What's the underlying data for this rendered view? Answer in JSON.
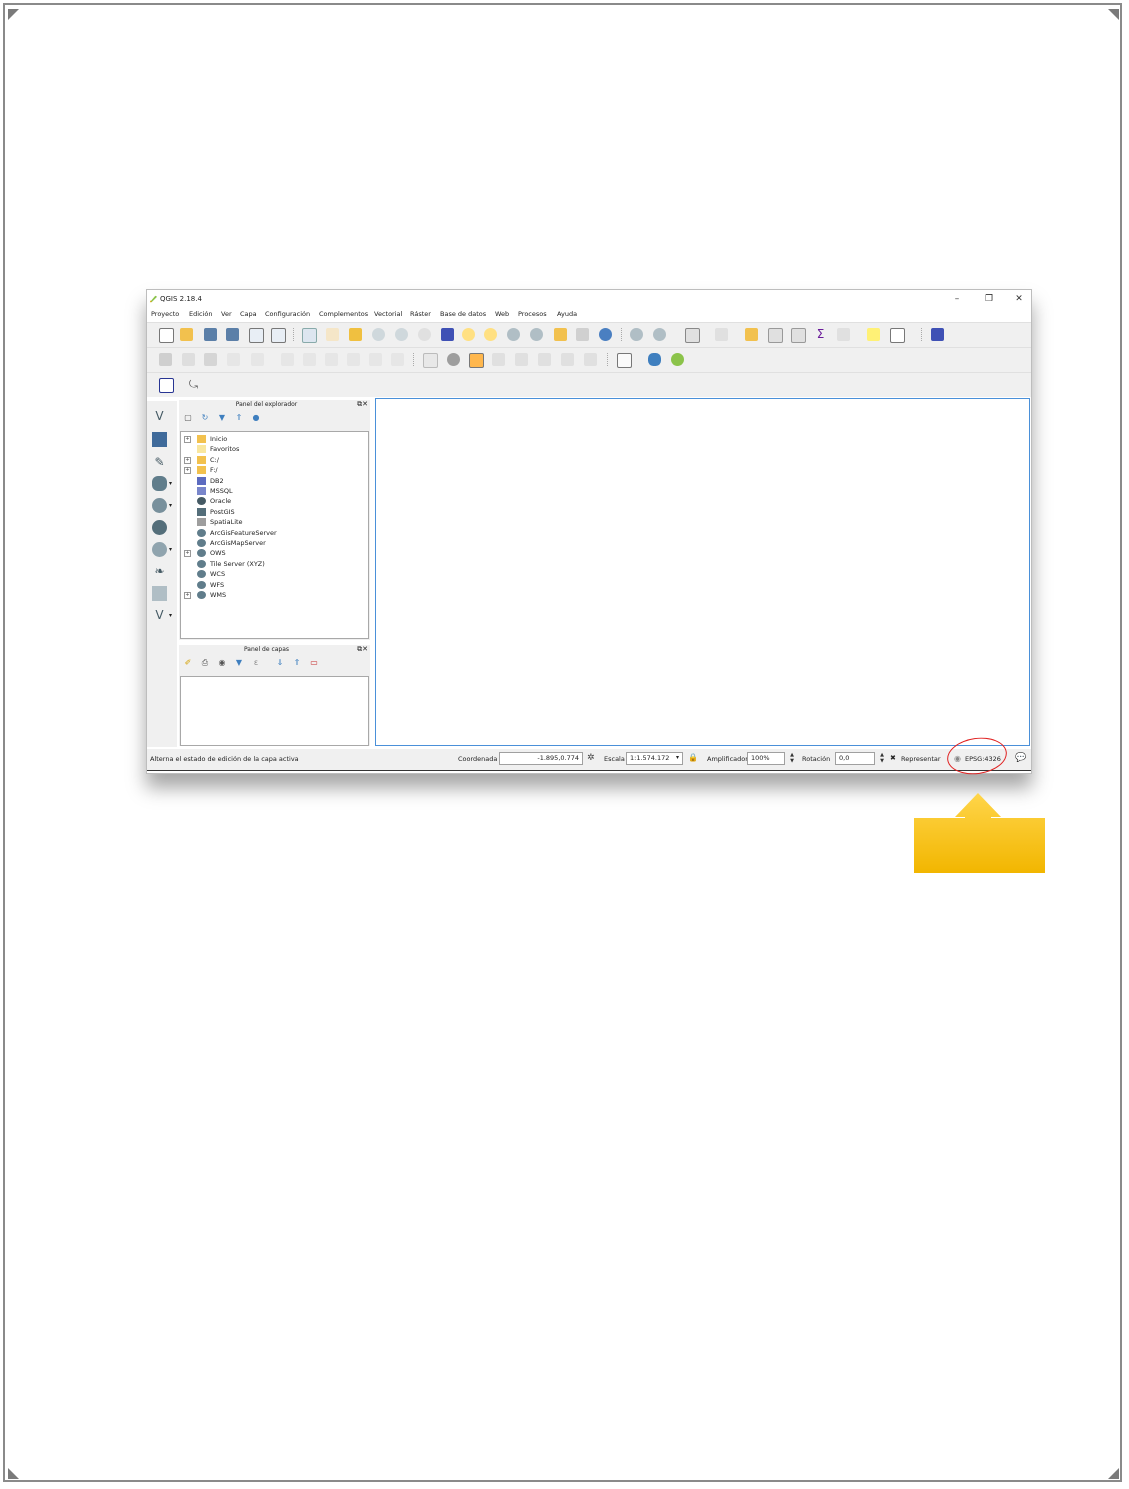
{
  "window": {
    "title": "QGIS 2.18.4",
    "controls": [
      "–",
      "❐",
      "✕"
    ]
  },
  "menu": [
    "Proyecto",
    "Edición",
    "Ver",
    "Capa",
    "Configuración",
    "Complementos",
    "Vectorial",
    "Ráster",
    "Base de datos",
    "Web",
    "Procesos",
    "Ayuda"
  ],
  "browser_panel": {
    "title": "Panel del explorador",
    "items": [
      {
        "label": "Inicio",
        "icon": "folder-icon",
        "expandable": true
      },
      {
        "label": "Favoritos",
        "icon": "star-icon",
        "expandable": false
      },
      {
        "label": "C:/",
        "icon": "folder-icon",
        "expandable": true
      },
      {
        "label": "F:/",
        "icon": "folder-icon",
        "expandable": true
      },
      {
        "label": "DB2",
        "icon": "db2-icon",
        "expandable": false
      },
      {
        "label": "MSSQL",
        "icon": "mssql-icon",
        "expandable": false
      },
      {
        "label": "Oracle",
        "icon": "oracle-icon",
        "expandable": false
      },
      {
        "label": "PostGIS",
        "icon": "postgis-icon",
        "expandable": false
      },
      {
        "label": "SpatiaLite",
        "icon": "spatialite-icon",
        "expandable": false
      },
      {
        "label": "ArcGisFeatureServer",
        "icon": "globe-icon",
        "expandable": false
      },
      {
        "label": "ArcGisMapServer",
        "icon": "globe-icon",
        "expandable": false
      },
      {
        "label": "OWS",
        "icon": "globe-icon",
        "expandable": true
      },
      {
        "label": "Tile Server (XYZ)",
        "icon": "globe-icon",
        "expandable": false
      },
      {
        "label": "WCS",
        "icon": "globe-icon",
        "expandable": false
      },
      {
        "label": "WFS",
        "icon": "globe-icon",
        "expandable": false
      },
      {
        "label": "WMS",
        "icon": "globe-icon",
        "expandable": true
      }
    ]
  },
  "layers_panel": {
    "title": "Panel de capas"
  },
  "statusbar": {
    "message": "Alterna el estado de edición de la capa activa",
    "coordinate_label": "Coordenada",
    "coordinate_value": "-1.895,0.774",
    "scale_label": "Escala",
    "scale_value": "1:1.574.172",
    "magnifier_label": "Amplificador",
    "magnifier_value": "100%",
    "rotation_label": "Rotación",
    "rotation_value": "0,0",
    "render_label": "Representar",
    "crs_value": "EPSG:4326"
  },
  "colors": {
    "annotation_circle": "#e02020",
    "arrow_top": "#ffd54a",
    "arrow_bottom": "#f2b600",
    "canvas_border": "#4a90d9"
  }
}
